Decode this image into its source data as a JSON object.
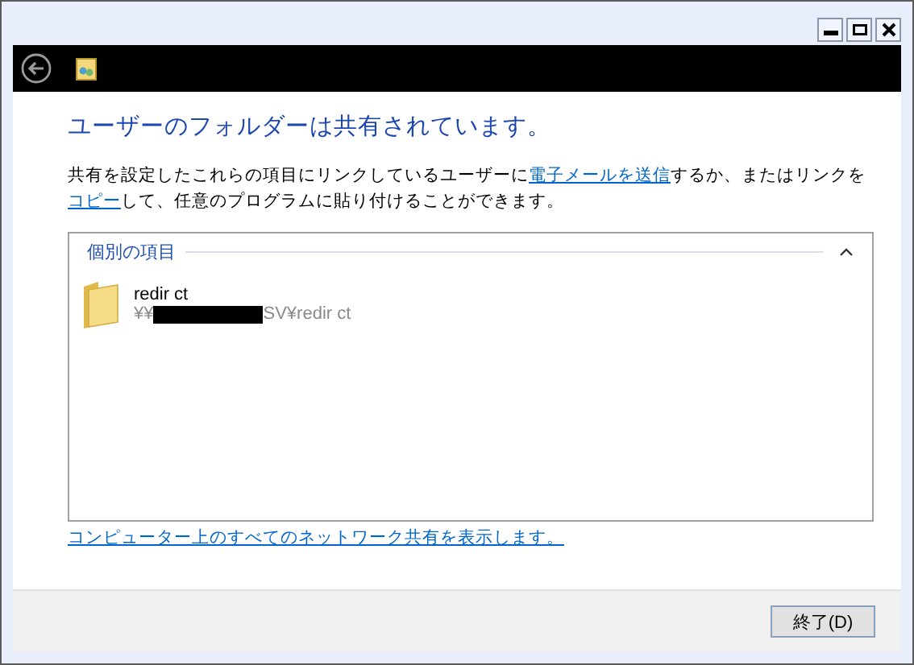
{
  "heading": "ユーザーのフォルダーは共有されています。",
  "description": [
    {
      "kind": "text",
      "text": "共有を設定したこれらの項目にリンクしているユーザーに"
    },
    {
      "kind": "link",
      "text": "電子メールを送信"
    },
    {
      "kind": "text",
      "text": "するか、またはリンクを"
    },
    {
      "kind": "link",
      "text": "コピー"
    },
    {
      "kind": "text",
      "text": "して、任意のプログラムに貼り付けることができます。"
    }
  ],
  "group": {
    "title": "個別の項目",
    "expanded": true,
    "items": [
      {
        "name": "redir ct",
        "path_prefix": "¥¥",
        "path_suffix": "SV¥redir ct",
        "redacted": true
      }
    ]
  },
  "network_link": "コンピューター上のすべてのネットワーク共有を表示します。",
  "buttons": [
    "終了(D)"
  ]
}
